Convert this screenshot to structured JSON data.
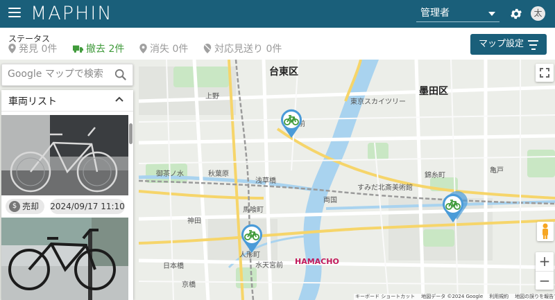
{
  "header": {
    "logo_text": "MAPHIN",
    "admin_label": "管理者",
    "avatar_initial": "太"
  },
  "status": {
    "title": "ステータス",
    "items": [
      {
        "label": "発見 0件",
        "icon": "map-pin-icon",
        "state": "inactive"
      },
      {
        "label": "撤去 2件",
        "icon": "truck-icon",
        "state": "active"
      },
      {
        "label": "消失 0件",
        "icon": "map-pin-icon",
        "state": "inactive"
      },
      {
        "label": "対応見送り 0件",
        "icon": "pin-off-icon",
        "state": "inactive"
      }
    ],
    "map_settings_label": "マップ設定"
  },
  "search": {
    "placeholder": "Google マップで検索"
  },
  "vehicle_list": {
    "title": "車両リスト",
    "items": [
      {
        "status": "売却",
        "datetime": "2024/09/17 11:10",
        "photo": "bicycle-photo"
      },
      {
        "status": "",
        "datetime": "",
        "photo": "bicycle-photo"
      }
    ]
  },
  "map": {
    "labels": {
      "taito": "台東区",
      "sumida": "墨田区",
      "hamacho": "HAMACHO",
      "asakusabashi": "浅草橋",
      "bakurocho": "馬喰町",
      "ningyocho": "人形町",
      "ochanomizu": "御茶ノ水",
      "kanda": "神田",
      "akihabara": "秋葉原",
      "ryogoku": "両国",
      "kinshicho": "錦糸町",
      "tokyo_skytree": "東京スカイツリー",
      "ueno": "上野",
      "kuramae": "蔵前",
      "hokusai": "すみだ北斎美術館",
      "kameido": "亀戸",
      "suitengumae": "水天宮前",
      "nihonbashi": "日本橋",
      "kyobashi": "京橋"
    },
    "attribution": [
      "キーボード ショートカット",
      "地図データ ©2024 Google",
      "利用規約",
      "地図の誤りを報告する"
    ],
    "zoom_in": "+",
    "zoom_out": "−"
  },
  "colors": {
    "brand": "#1a5f7a",
    "active_status": "#3f9a3a",
    "pin_fill": "#4a9bd8",
    "pin_icon": "#3f9a3a"
  }
}
